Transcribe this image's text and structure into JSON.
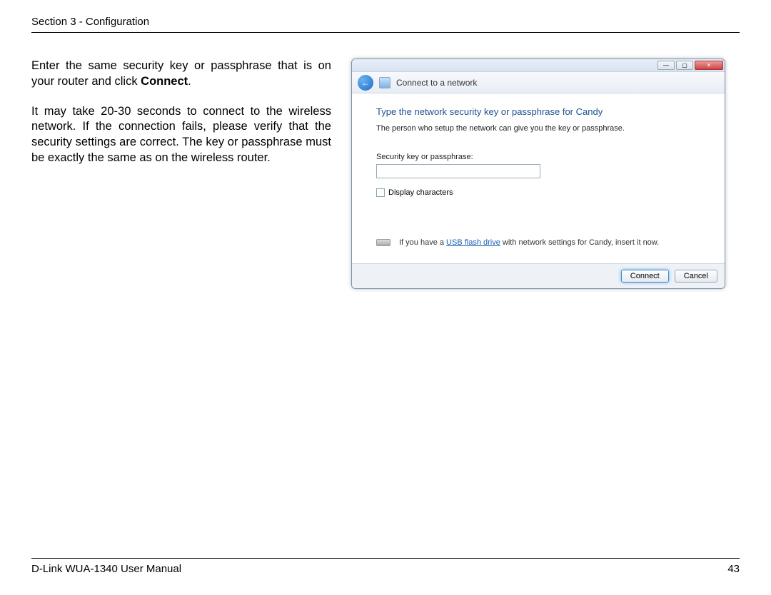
{
  "header": {
    "section": "Section 3 - Configuration"
  },
  "instructions": {
    "p1_a": "Enter the same security key or passphrase that is on your router and click ",
    "p1_bold": "Connect",
    "p1_b": ".",
    "p2": "It may take 20-30 seconds to connect to the wireless network. If the connection fails, please verify that the security settings are correct. The key or passphrase must be exactly the same as on the wireless router."
  },
  "dialog": {
    "window_min": "—",
    "window_max": "▢",
    "window_close": "✕",
    "back_arrow": "←",
    "nav_title": "Connect to a network",
    "heading": "Type the network security key or passphrase for Candy",
    "subtext": "The person who setup the network can give you the key or passphrase.",
    "field_label": "Security key or passphrase:",
    "input_value": "",
    "display_chars": "Display characters",
    "usb_a": "If you have a ",
    "usb_link": "USB flash drive",
    "usb_b": " with network settings for Candy, insert it now.",
    "connect": "Connect",
    "cancel": "Cancel"
  },
  "footer": {
    "manual": "D-Link WUA-1340 User Manual",
    "page": "43"
  }
}
